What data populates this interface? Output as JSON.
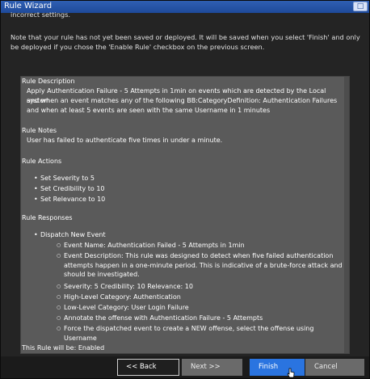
{
  "window": {
    "title": "Rule Wizard"
  },
  "intro": {
    "cut_line": "incorrect settings.",
    "note": "Note that your rule has not yet been saved or deployed. It will be saved when you select 'Finish' and only be deployed if you chose the 'Enable Rule' checkbox on the previous screen."
  },
  "summary": {
    "description_header": "Rule Description",
    "description_lines": [
      "Apply Authentication Failure - 5 Attempts in 1min on events which are detected by the Local system",
      "and when an event matches any of the following BB:CategoryDefinition: Authentication Failures",
      "and when at least 5 events are seen with the same Username in 1 minutes"
    ],
    "notes_header": "Rule Notes",
    "notes": "User has failed to authenticate five times in under a minute.",
    "actions_header": "Rule Actions",
    "actions": [
      "Set Severity to 5",
      "Set Credibility to 10",
      "Set Relevance to 10"
    ],
    "responses_header": "Rule Responses",
    "response_item": "Dispatch New Event",
    "response_details": [
      "Event Name: Authentication Failed - 5 Attempts in 1min",
      "Event Description: This rule was designed to detect when five failed authentication attempts happen in a one-minute period. This is indicative of a brute-force attack and should be investigated.",
      "Severity: 5 Credibility: 10 Relevance: 10",
      "High-Level Category: Authentication",
      "Low-Level Category: User Login Failure",
      "Annotate the offense with Authentication Failure - 5 Attempts",
      "Force the dispatched event to create a NEW offense, select the offense using Username"
    ],
    "status": "This Rule will be: Enabled"
  },
  "buttons": {
    "back": "<< Back",
    "next": "Next >>",
    "finish": "Finish",
    "cancel": "Cancel"
  },
  "icons": {
    "close": "close-icon",
    "cursor": "hand-cursor-icon"
  },
  "colors": {
    "titlebar": "#2f5fb3",
    "finish": "#2a74e0",
    "panel": "#5a5a5a"
  }
}
